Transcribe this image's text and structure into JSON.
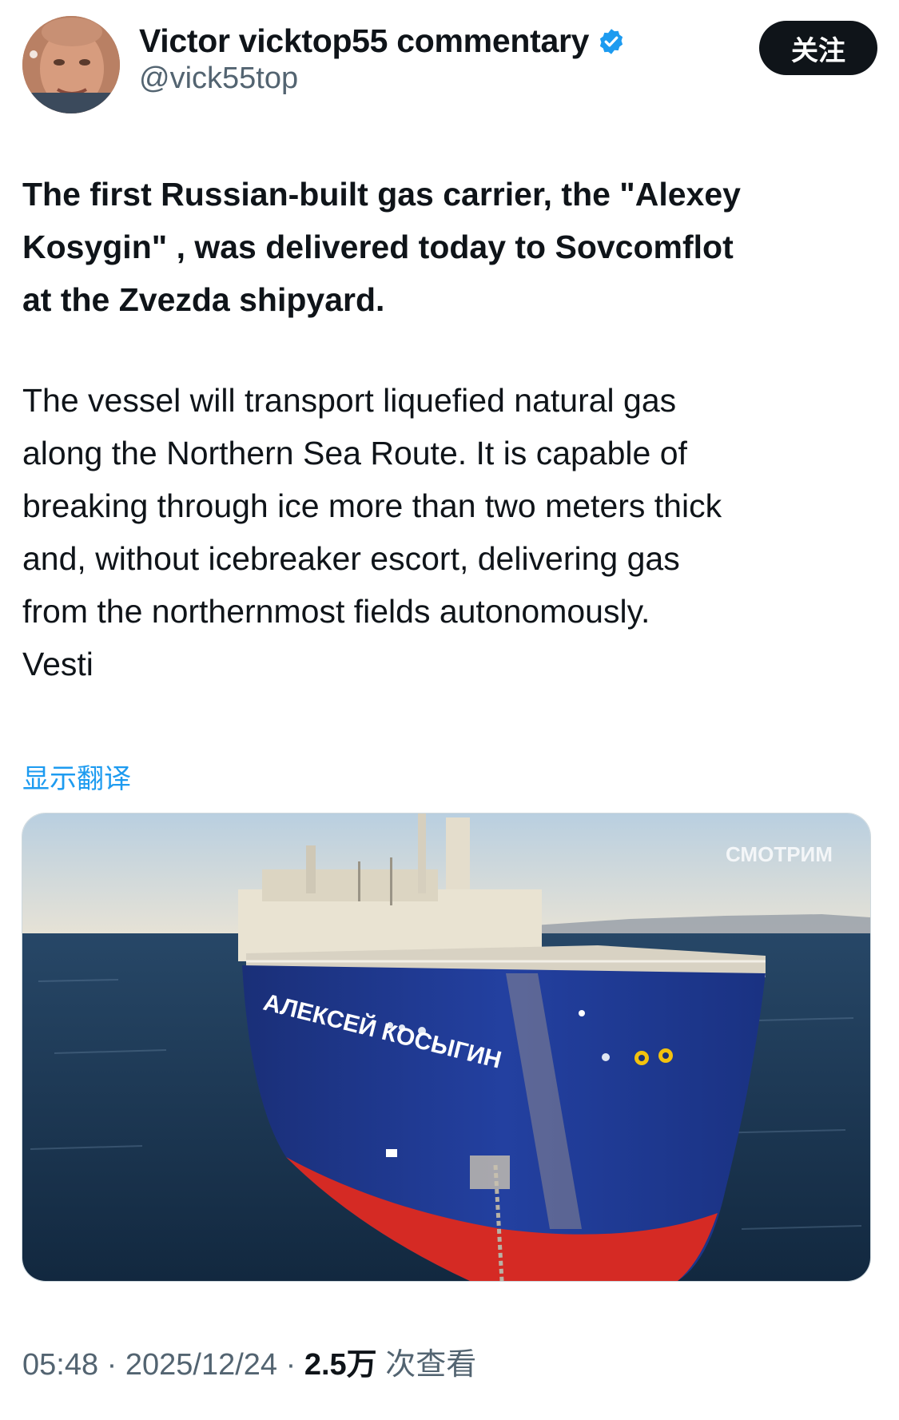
{
  "author": {
    "display_name": "Victor vicktop55 commentary",
    "handle": "@vick55top",
    "verified_icon": "verified-badge-icon",
    "avatar_icon": "avatar-photo"
  },
  "follow_button": {
    "label": "关注"
  },
  "tweet": {
    "lead_lines": [
      "The first Russian-built gas carrier, the \"Alexey",
      "Kosygin\" , was delivered today to Sovcomflot",
      "at the Zvezda shipyard."
    ],
    "body_lines": [
      "The vessel will transport liquefied natural gas",
      "along the Northern Sea Route. It is capable of",
      "breaking through ice more than two meters thick",
      "and, without icebreaker escort, delivering gas",
      "from the northernmost fields autonomously.",
      "Vesti"
    ]
  },
  "translate_link": "显示翻译",
  "media": {
    "watermark": "СМОТРИМ",
    "ship_name": "АЛЕКСЕЙ КОСЫГИН"
  },
  "meta": {
    "time": "05:48",
    "separator": "·",
    "date": "2025/12/24",
    "views_count": "2.5万",
    "views_label": "次查看"
  },
  "colors": {
    "link_blue": "#1d9bf0",
    "text_primary": "#0f1419",
    "text_secondary": "#536471",
    "hull_blue": "#1f3a8a",
    "hull_red": "#d52a24"
  }
}
